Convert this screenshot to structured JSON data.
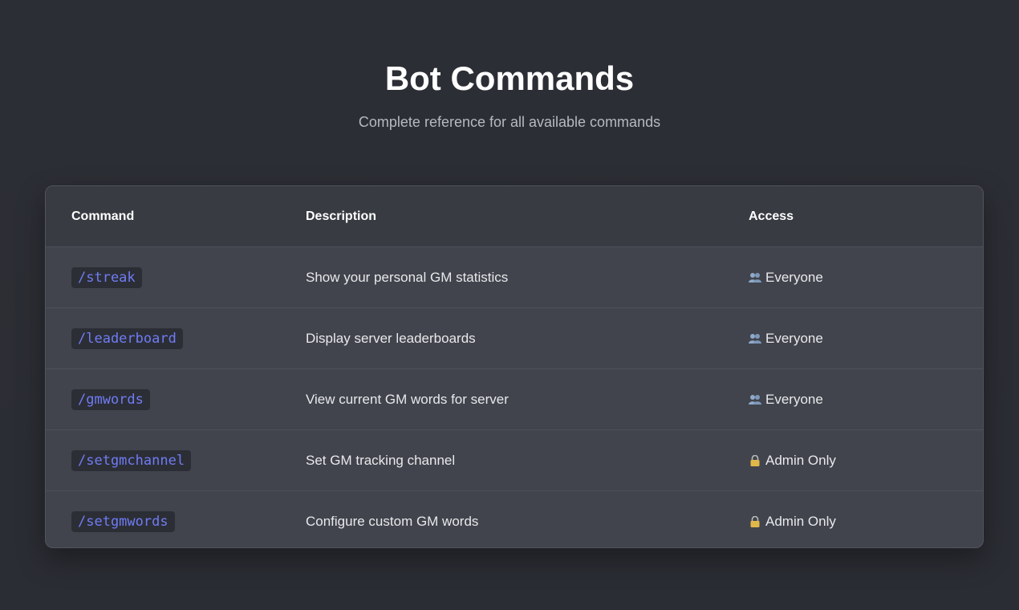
{
  "header": {
    "title": "Bot Commands",
    "subtitle": "Complete reference for all available commands"
  },
  "table": {
    "columns": [
      "Command",
      "Description",
      "Access"
    ],
    "rows": [
      {
        "command": "/streak",
        "description": "Show your personal GM statistics",
        "access": "Everyone",
        "icon": "people-icon"
      },
      {
        "command": "/leaderboard",
        "description": "Display server leaderboards",
        "access": "Everyone",
        "icon": "people-icon"
      },
      {
        "command": "/gmwords",
        "description": "View current GM words for server",
        "access": "Everyone",
        "icon": "people-icon"
      },
      {
        "command": "/setgmchannel",
        "description": "Set GM tracking channel",
        "access": "Admin Only",
        "icon": "lock-icon"
      },
      {
        "command": "/setgmwords",
        "description": "Configure custom GM words",
        "access": "Admin Only",
        "icon": "lock-icon"
      }
    ]
  },
  "colors": {
    "background": "#2b2d35",
    "card": "#41444c",
    "command_text": "#6f7cf5"
  }
}
